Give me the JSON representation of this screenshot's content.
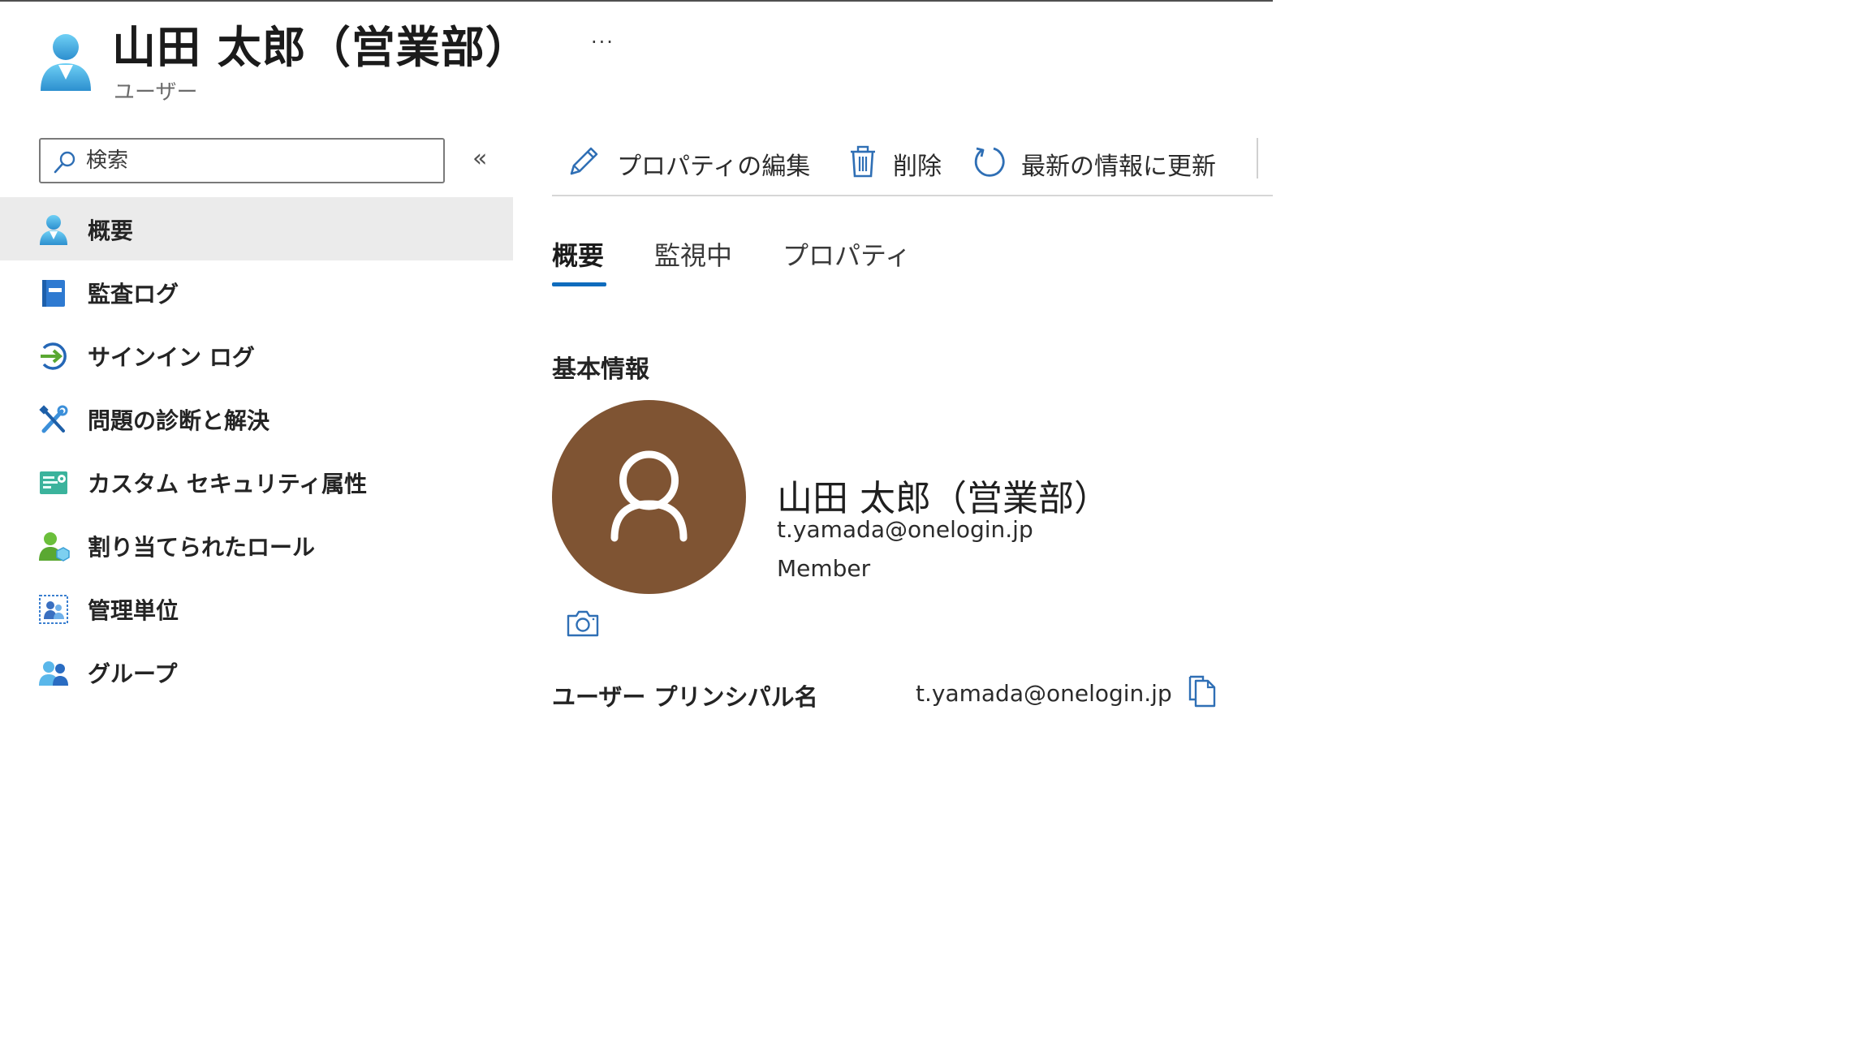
{
  "header": {
    "title": "山田 太郎（営業部）",
    "subtitle": "ユーザー",
    "more_label": "···"
  },
  "sidebar": {
    "search_placeholder": "検索",
    "collapse_label": "«",
    "items": [
      {
        "label": "概要",
        "icon": "user-icon",
        "active": true
      },
      {
        "label": "監査ログ",
        "icon": "audit-log-icon"
      },
      {
        "label": "サインイン ログ",
        "icon": "sign-in-arrow-icon"
      },
      {
        "label": "問題の診断と解決",
        "icon": "wrench-screwdriver-icon"
      },
      {
        "label": "カスタム セキュリティ属性",
        "icon": "security-attributes-icon"
      },
      {
        "label": "割り当てられたロール",
        "icon": "user-role-icon"
      },
      {
        "label": "管理単位",
        "icon": "admin-units-icon"
      },
      {
        "label": "グループ",
        "icon": "group-icon"
      }
    ]
  },
  "toolbar": {
    "edit_label": "プロパティの編集",
    "delete_label": "削除",
    "refresh_label": "最新の情報に更新"
  },
  "tabs": [
    {
      "label": "概要",
      "active": true
    },
    {
      "label": "監視中"
    },
    {
      "label": "プロパティ"
    }
  ],
  "content": {
    "section_title": "基本情報",
    "profile": {
      "name": "山田 太郎（営業部）",
      "email": "t.yamada@onelogin.jp",
      "user_type": "Member",
      "avatar_color": "#7f5433"
    },
    "upn": {
      "label": "ユーザー プリンシパル名",
      "value": "t.yamada@onelogin.jp"
    }
  },
  "colors": {
    "accent": "#0f6cbd",
    "active_nav_bg": "#ebebeb"
  }
}
